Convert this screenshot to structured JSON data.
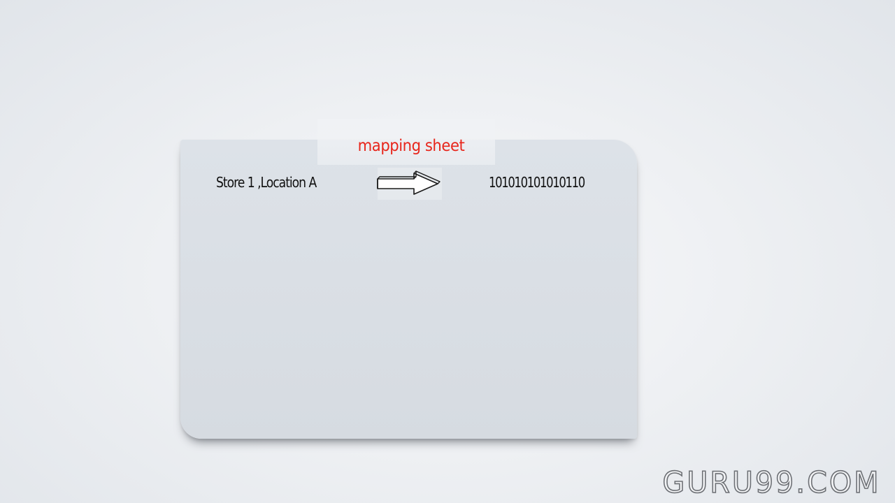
{
  "sheet": {
    "title": "mapping sheet",
    "rows": [
      {
        "label": "Store 1 ,Location A",
        "arrow_icon": "hand-drawn-right-arrow-icon",
        "value": "101010101010110"
      }
    ]
  },
  "watermark": {
    "text": "GURU99.COM"
  },
  "colors": {
    "title": "#e8261c",
    "sheet": "#dde2e8",
    "background": "#eef0f3",
    "text": "#111111"
  }
}
